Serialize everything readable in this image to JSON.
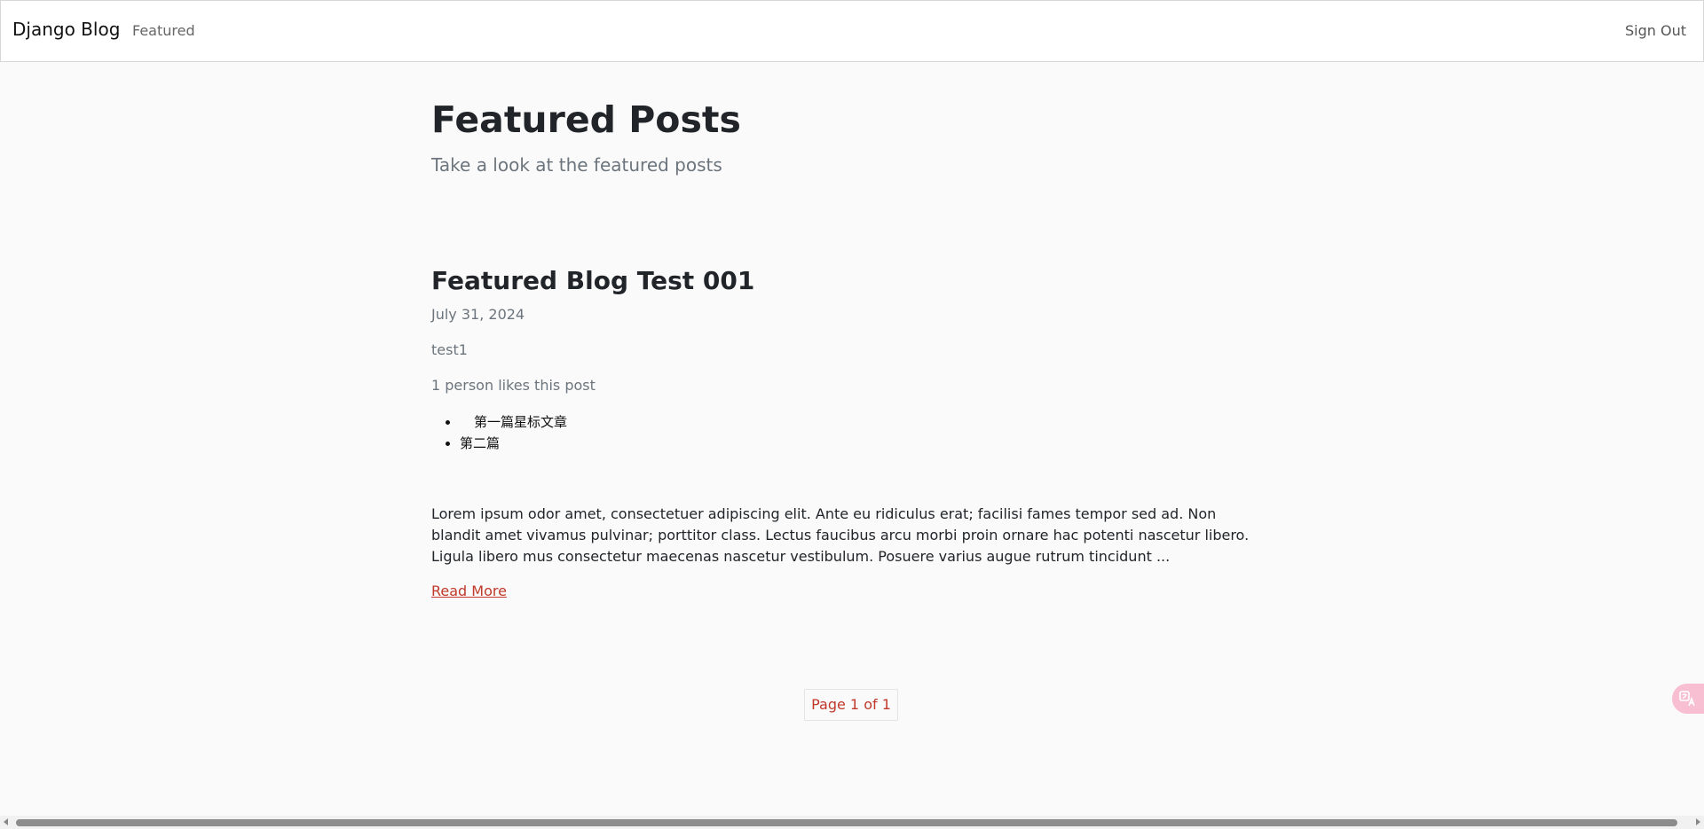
{
  "nav": {
    "brand": "Django Blog",
    "featured": "Featured",
    "sign_out": "Sign Out"
  },
  "header": {
    "title": "Featured Posts",
    "subtitle": "Take a look at the featured posts"
  },
  "post": {
    "title": "Featured Blog Test 001",
    "date": "July 31, 2024",
    "author": "test1",
    "likes": "1 person likes this post",
    "categories": [
      "第一篇星标文章",
      "第二篇"
    ],
    "excerpt": "Lorem ipsum odor amet, consectetuer adipiscing elit. Ante eu ridiculus erat; facilisi fames tempor sed ad. Non blandit amet vivamus pulvinar; porttitor class. Lectus faucibus arcu morbi proin ornare hac potenti nascetur libero. Ligula libero mus consectetur maecenas nascetur vestibulum. Posuere varius augue rutrum tincidunt ...",
    "read_more": "Read More"
  },
  "pagination": {
    "label": "Page 1 of 1"
  },
  "widgets": {
    "translate_icon": "translate-icon"
  },
  "colors": {
    "accent": "#c0392b",
    "background": "#fafafa",
    "translate_bg": "#f8bfd3"
  }
}
